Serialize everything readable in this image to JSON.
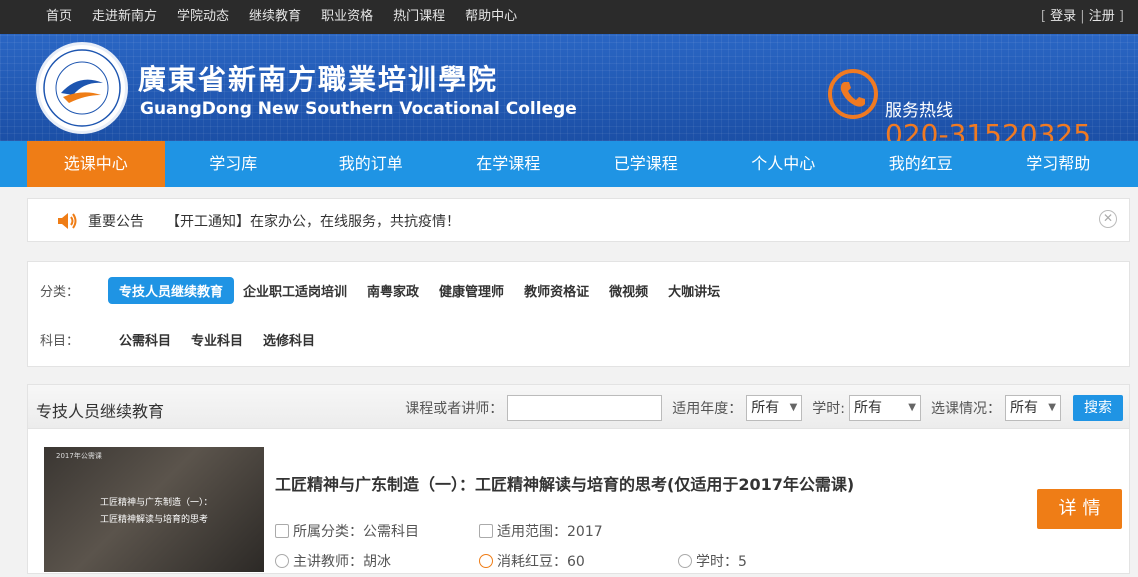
{
  "topbar": {
    "links": [
      "首页",
      "走进新南方",
      "学院动态",
      "继续教育",
      "职业资格",
      "热门课程",
      "帮助中心"
    ],
    "login": "登录",
    "register": "注册",
    "separator_left": "[",
    "separator_mid": "|",
    "separator_right": "]"
  },
  "banner": {
    "school_name_cn": "廣東省新南方職業培训學院",
    "school_name_en": "GuangDong New Southern Vocational College",
    "hotline_label": "服务热线",
    "hotline_number": "020-31520325"
  },
  "mainnav": {
    "items": [
      "选课中心",
      "学习库",
      "我的订单",
      "在学课程",
      "已学课程",
      "个人中心",
      "我的红豆",
      "学习帮助"
    ],
    "active_index": 0
  },
  "notice": {
    "label": "重要公告",
    "text": "【开工通知】在家办公，在线服务，共抗疫情！"
  },
  "filter": {
    "category_label": "分类：",
    "categories": [
      "专技人员继续教育",
      "企业职工适岗培训",
      "南粤家政",
      "健康管理师",
      "教师资格证",
      "微视频",
      "大咖讲坛"
    ],
    "selected_category": 0,
    "subject_label": "科目：",
    "subjects": [
      "公需科目",
      "专业科目",
      "选修科目"
    ]
  },
  "list": {
    "title": "专技人员继续教育",
    "search_label": "课程或者讲师：",
    "search_value": "",
    "year_label": "适用年度：",
    "year_value": "所有",
    "hours_label": "学时:",
    "hours_value": "所有",
    "status_label": "选课情况：",
    "status_value": "所有",
    "search_button": "搜索"
  },
  "course": {
    "thumb_tag": "2017年公需课",
    "thumb_line1": "工匠精神与广东制造（一）：",
    "thumb_line2": "工匠精神解读与培育的思考",
    "title": "工匠精神与广东制造（一）：工匠精神解读与培育的思考(仅适用于2017年公需课)",
    "category_label": "所属分类：",
    "category_value": "公需科目",
    "scope_label": "适用范围：",
    "scope_value": "2017",
    "teacher_label": "主讲教师：",
    "teacher_value": "胡冰",
    "beans_label": "消耗红豆：",
    "beans_value": "60",
    "hours_label": "学时：",
    "hours_value": "5",
    "detail_button": "详情"
  },
  "colors": {
    "accent_blue": "#1f94e4",
    "accent_orange": "#ef7d16",
    "banner_blue": "#1d55b0"
  }
}
